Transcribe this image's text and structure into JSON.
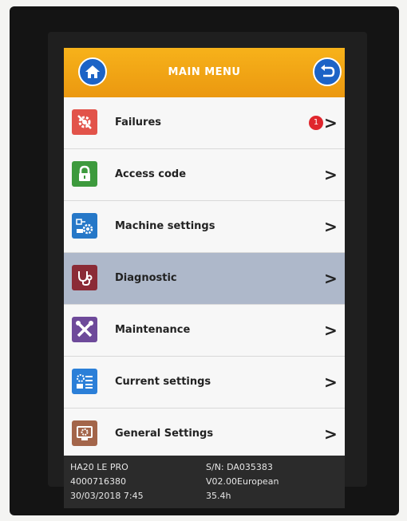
{
  "header": {
    "title": "MAIN MENU",
    "home_icon": "home-icon",
    "back_icon": "back-arrow-icon"
  },
  "colors": {
    "header": "#f29f13",
    "selected_row": "#aeb8ca",
    "badge": "#e0262d"
  },
  "menu": {
    "items": [
      {
        "label": "Failures",
        "icon": "failure-gear-icon",
        "icon_color": "#e2534a",
        "badge": "1",
        "selected": false
      },
      {
        "label": "Access code",
        "icon": "padlock-icon",
        "icon_color": "#3d9a3d",
        "selected": false
      },
      {
        "label": "Machine settings",
        "icon": "machine-settings-icon",
        "icon_color": "#2678c8",
        "selected": false
      },
      {
        "label": "Diagnostic",
        "icon": "stethoscope-icon",
        "icon_color": "#8b2b36",
        "selected": true
      },
      {
        "label": "Maintenance",
        "icon": "tools-icon",
        "icon_color": "#6e4a9a",
        "selected": false
      },
      {
        "label": "Current settings",
        "icon": "current-settings-icon",
        "icon_color": "#2b7fd8",
        "selected": false
      },
      {
        "label": "General Settings",
        "icon": "general-settings-icon",
        "icon_color": "#a3654a",
        "selected": false
      }
    ],
    "chevron": ">"
  },
  "footer": {
    "model": "HA20 LE PRO",
    "number": "4000716380",
    "datetime": "30/03/2018 7:45",
    "serial": "S/N: DA035383",
    "version": "V02.00European",
    "hours": "35.4h"
  }
}
